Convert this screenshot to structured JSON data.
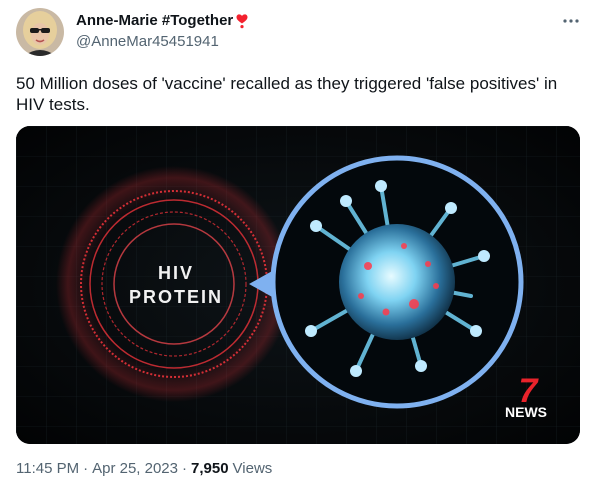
{
  "author": {
    "display_name": "Anne-Marie #Together",
    "handle": "@AnneMar45451941",
    "name_emoji_icon": "red-heart-exclamation-icon",
    "avatar_icon": "profile-avatar"
  },
  "more_menu_icon": "more-dots-icon",
  "tweet": {
    "text": "50 Million doses of 'vaccine' recalled as they triggered 'false positives' in HIV tests."
  },
  "media": {
    "overlay_label_line1": "HIV",
    "overlay_label_line2": "PROTEIN",
    "network_logo_number": "7",
    "network_logo_text": "NEWS"
  },
  "meta": {
    "time": "11:45 PM",
    "separator": "·",
    "date": "Apr 25, 2023",
    "views_count": "7,950",
    "views_label": "Views"
  },
  "colors": {
    "text_primary": "#0f1419",
    "text_secondary": "#536471",
    "heart": "#f4212e",
    "ring_red": "#e8323a",
    "ring_blue": "#7fb1f0"
  }
}
